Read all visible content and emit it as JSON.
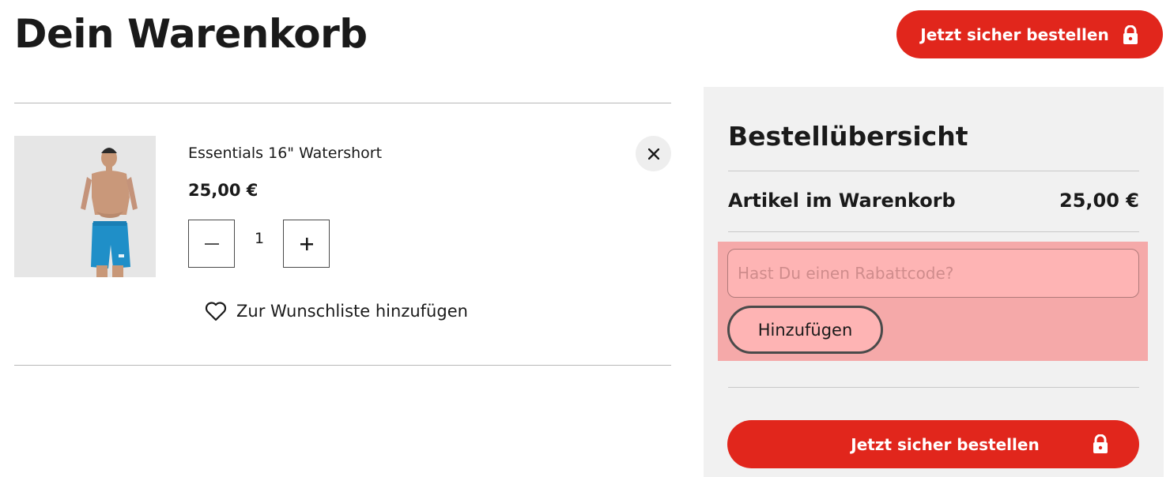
{
  "page": {
    "title": "Dein Warenkorb"
  },
  "checkout": {
    "top_label": "Jetzt sicher bestellen",
    "bottom_label": "Jetzt sicher bestellen"
  },
  "cart": {
    "items": [
      {
        "name": "Essentials 16\" Watershort",
        "price": "25,00 €",
        "quantity": "1",
        "wishlist_label": "Zur Wunschliste hinzufügen"
      }
    ]
  },
  "summary": {
    "title": "Bestellübersicht",
    "items_label": "Artikel im Warenkorb",
    "items_value": "25,00 €",
    "coupon_placeholder": "Hast Du einen Rabattcode?",
    "coupon_button": "Hinzufügen"
  },
  "colors": {
    "accent": "#e1261c",
    "panel": "#f1f1f1",
    "highlight": "#f5a9a9"
  },
  "icons": [
    "lock-icon",
    "minus-icon",
    "plus-icon",
    "close-icon",
    "heart-icon"
  ]
}
